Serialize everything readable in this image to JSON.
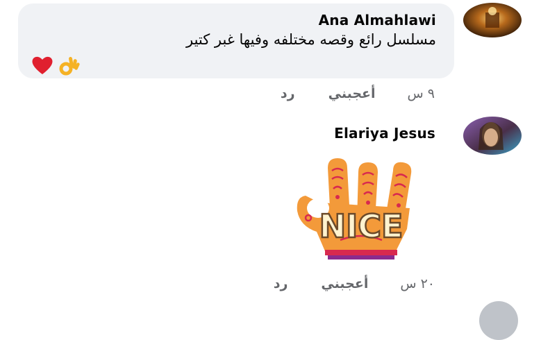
{
  "comments": [
    {
      "author": "Ana Almahlawi",
      "text": "مسلسل رائع وقصه مختلفه وفيها غبر كتير",
      "reactions": [
        "heart-emoji",
        "ok-hand-emoji"
      ],
      "time": "٩ س",
      "like_label": "أعجبني",
      "reply_label": "رد"
    },
    {
      "author": "Elariya Jesus",
      "sticker_text": "NICE",
      "time": "٢٠ س",
      "like_label": "أعجبني",
      "reply_label": "رد"
    }
  ],
  "colors": {
    "bubble_bg": "#f0f2f5",
    "secondary_text": "#65676b",
    "sticker_orange": "#f39a3a",
    "sticker_red": "#d8294f"
  }
}
